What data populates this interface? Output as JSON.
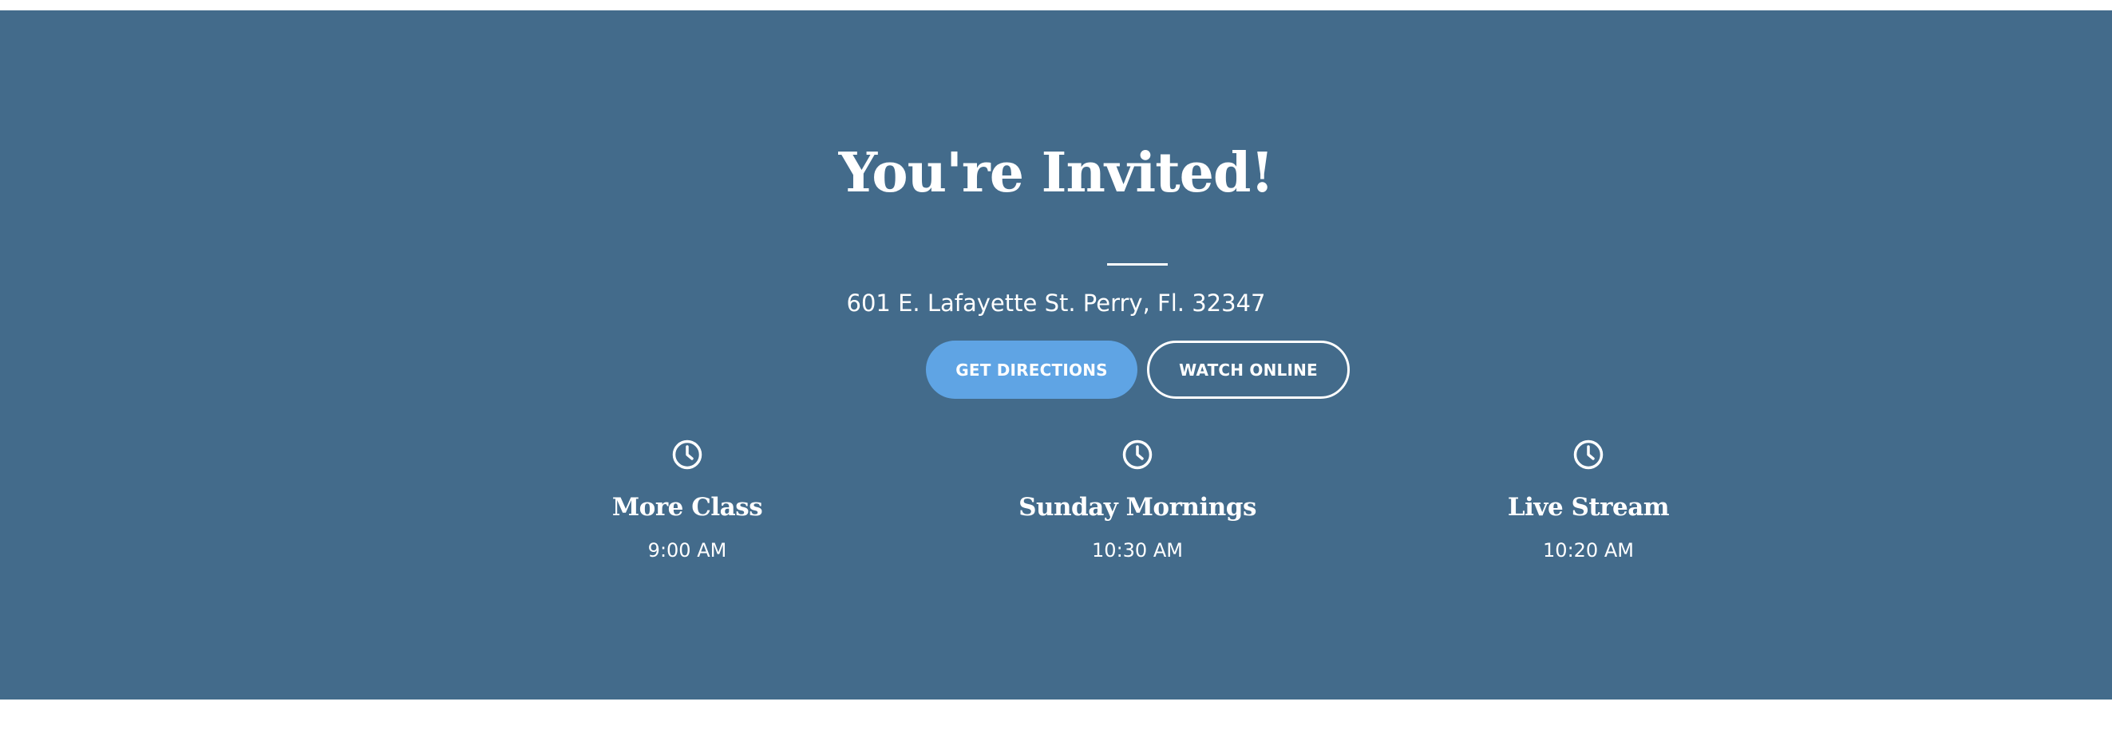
{
  "invite": {
    "title": "You're Invited!",
    "address": "601 E. Lafayette St. Perry, Fl. 32347"
  },
  "buttons": {
    "directions_label": "GET DIRECTIONS",
    "watch_label": "WATCH ONLINE"
  },
  "services": [
    {
      "name": "More Class",
      "time": "9:00 AM",
      "icon": "clock-icon"
    },
    {
      "name": "Sunday Mornings",
      "time": "10:30 AM",
      "icon": "clock-icon"
    },
    {
      "name": "Live Stream",
      "time": "10:20 AM",
      "icon": "clock-icon"
    }
  ],
  "colors": {
    "banner_background": "#436b8b",
    "primary_button": "#5fa4e4",
    "text": "#ffffff",
    "page_background": "#ffffff"
  }
}
